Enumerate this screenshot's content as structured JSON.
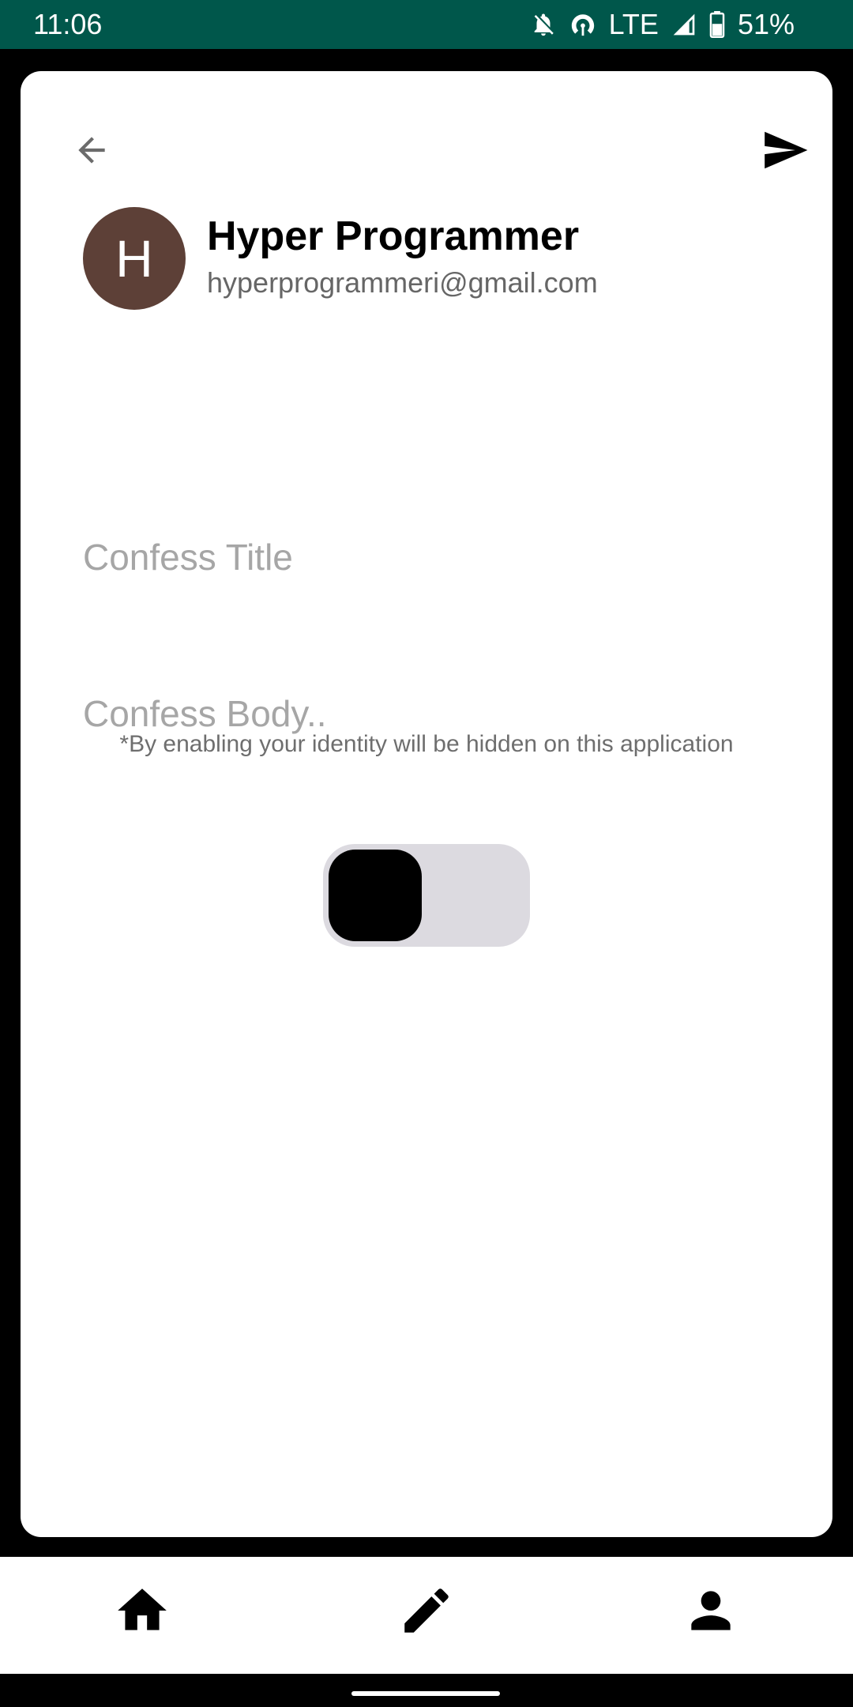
{
  "status_bar": {
    "time": "11:06",
    "network": "LTE",
    "battery": "51%",
    "icons": [
      "notifications-off-icon",
      "hotspot-icon",
      "signal-icon",
      "battery-icon"
    ],
    "background": "#00574b"
  },
  "header": {
    "back_icon": "arrow-back-icon",
    "send_icon": "send-icon"
  },
  "profile": {
    "avatar_letter": "H",
    "avatar_color": "#5d4037",
    "name": "Hyper Programmer",
    "email": "hyperprogrammeri@gmail.com"
  },
  "form": {
    "title_placeholder": "Confess Title",
    "title_value": "",
    "body_placeholder": "Confess Body..",
    "body_value": "",
    "anonymous_note": "*By enabling your identity will be hidden on this application",
    "anonymous_toggle_on": false
  },
  "bottom_nav": {
    "items": [
      {
        "icon": "home-icon"
      },
      {
        "icon": "edit-icon"
      },
      {
        "icon": "person-icon"
      }
    ]
  }
}
